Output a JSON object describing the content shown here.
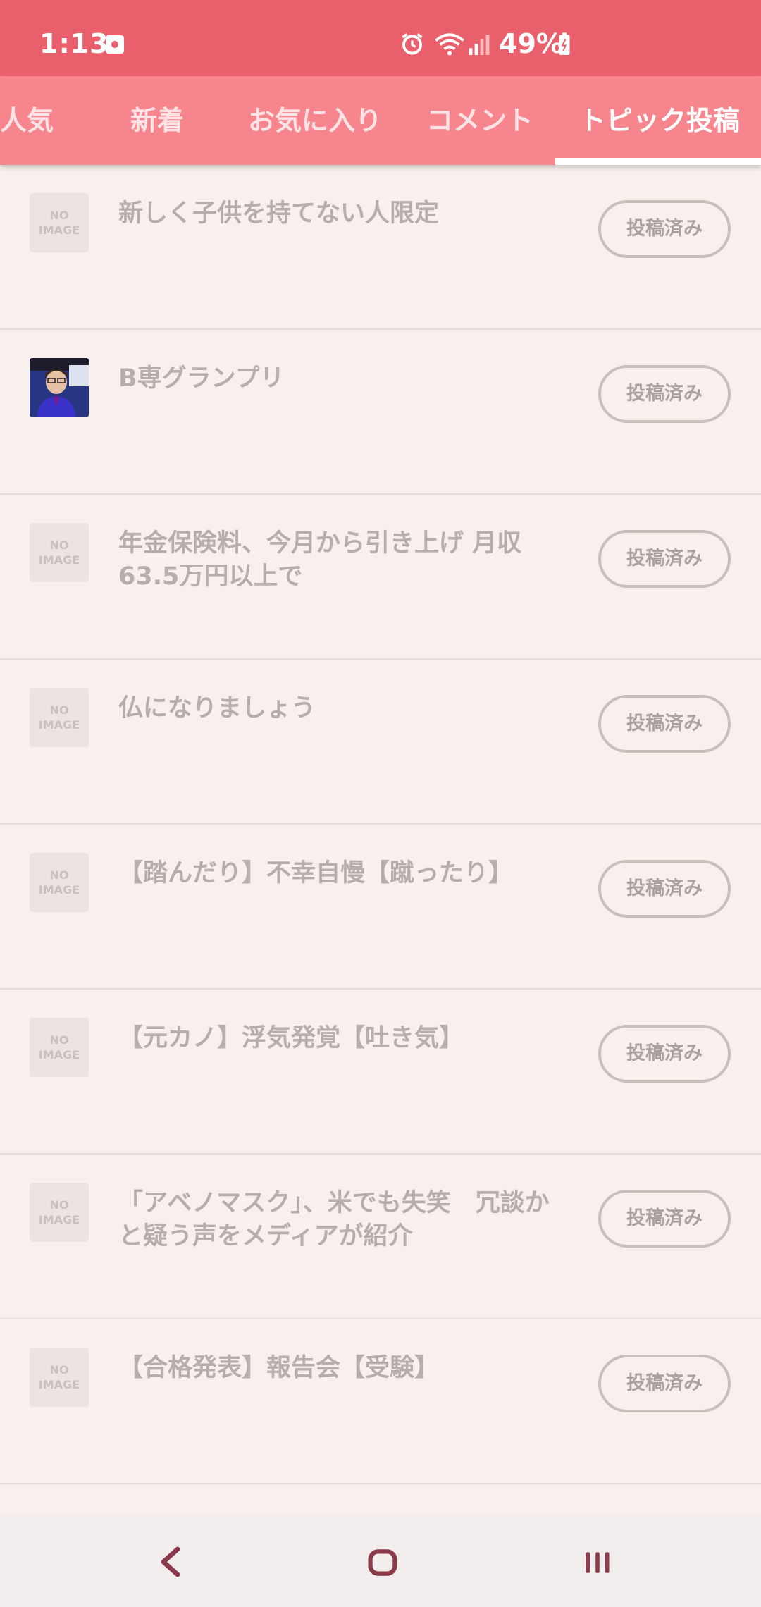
{
  "status_bar": {
    "time": "1:13",
    "battery": "49%",
    "icons": [
      "notification-icon",
      "alarm-icon",
      "wifi-icon",
      "signal-icon",
      "battery-icon"
    ]
  },
  "tabs": [
    {
      "label": "人気",
      "active": false
    },
    {
      "label": "新着",
      "active": false
    },
    {
      "label": "お気に入り",
      "active": false
    },
    {
      "label": "コメント",
      "active": false
    },
    {
      "label": "トピック投稿",
      "active": true
    }
  ],
  "topics": [
    {
      "title": "新しく子供を持てない人限定",
      "thumb": "NO IMAGE",
      "status": "投稿済み"
    },
    {
      "title": "B専グランプリ",
      "thumb": "photo",
      "status": "投稿済み"
    },
    {
      "title": "年金保険料、今月から引き上げ 月収63.5万円以上で",
      "thumb": "NO IMAGE",
      "status": "投稿済み"
    },
    {
      "title": "仏になりましょう",
      "thumb": "NO IMAGE",
      "status": "投稿済み"
    },
    {
      "title": "【踏んだり】不幸自慢【蹴ったり】",
      "thumb": "NO IMAGE",
      "status": "投稿済み"
    },
    {
      "title": "【元カノ】浮気発覚【吐き気】",
      "thumb": "NO IMAGE",
      "status": "投稿済み"
    },
    {
      "title": "「アベノマスク」、米でも失笑　冗談かと疑う声をメディアが紹介",
      "thumb": "NO IMAGE",
      "status": "投稿済み"
    },
    {
      "title": "【合格発表】報告会【受験】",
      "thumb": "NO IMAGE",
      "status": "投稿済み"
    }
  ],
  "no_image": {
    "line1": "NO",
    "line2": "IMAGE"
  },
  "colors": {
    "status_bar": "#ea5f6c",
    "tab_bar": "#f6858d",
    "background": "#f8f0ec"
  }
}
